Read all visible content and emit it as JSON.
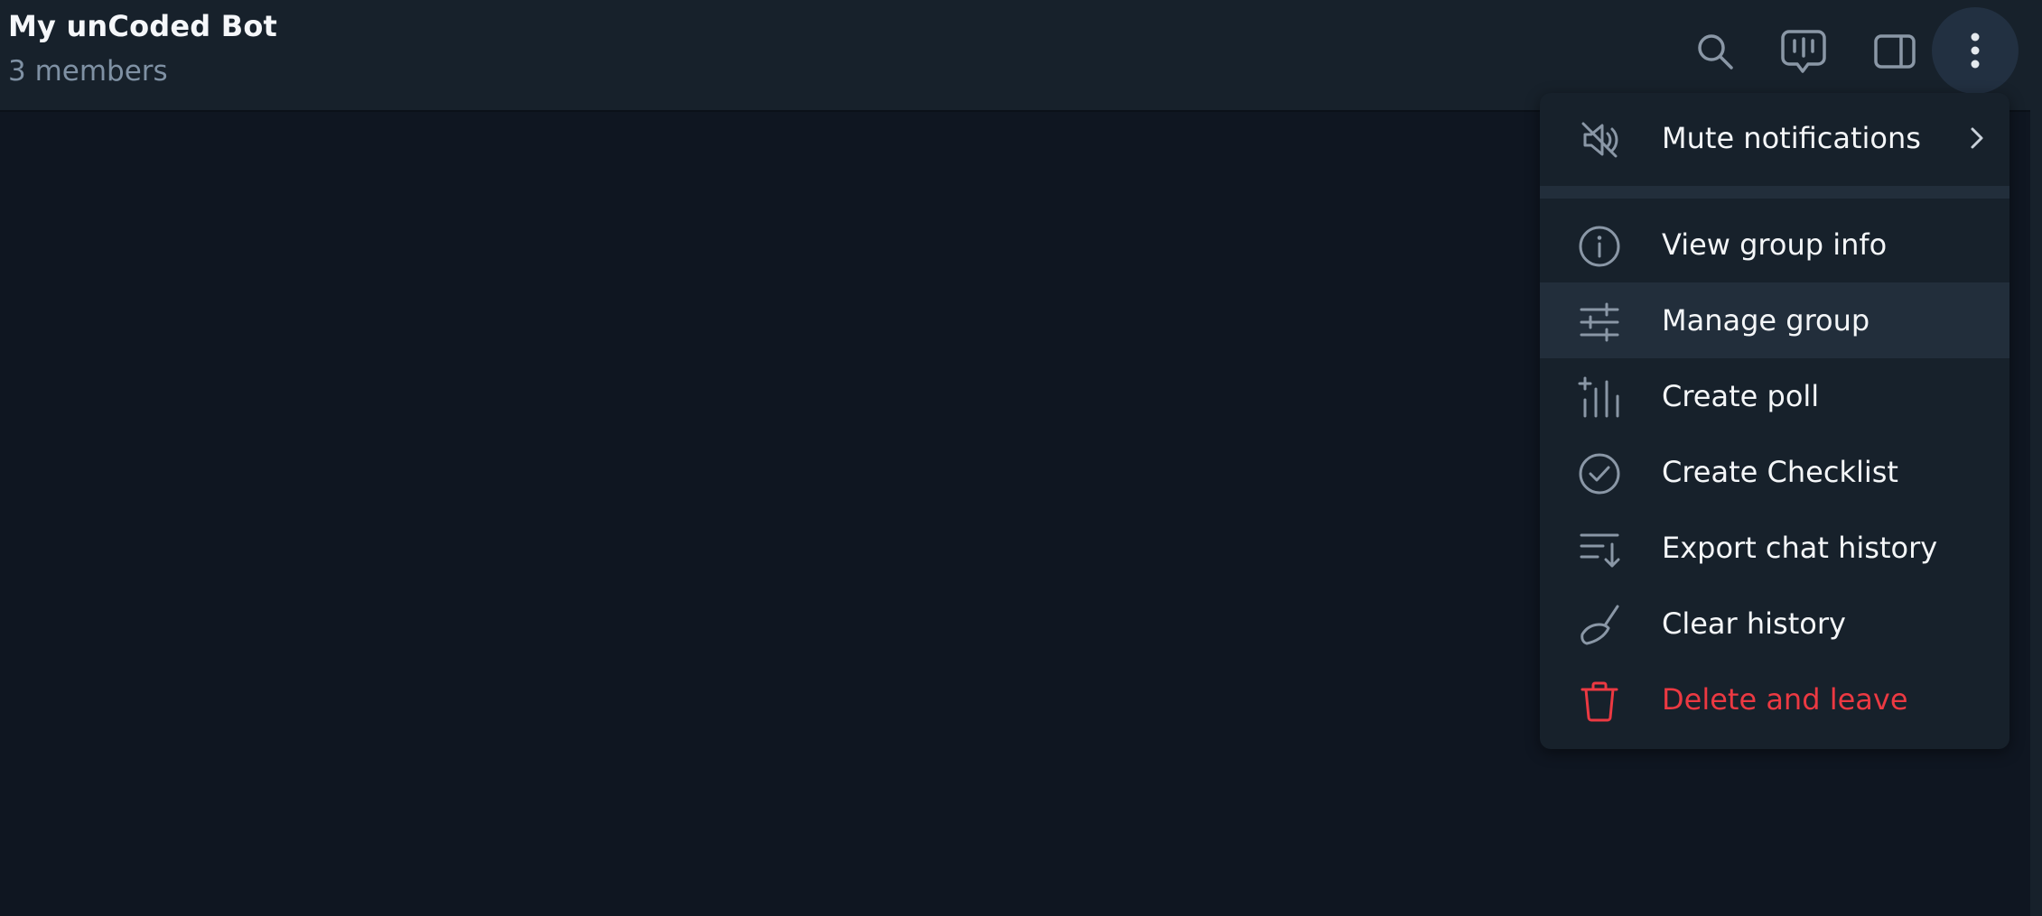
{
  "header": {
    "title": "My unCoded Bot",
    "subtitle": "3 members",
    "buttons": {
      "search": "search-icon",
      "video_chat": "video-chat-icon",
      "sidebar": "sidebar-toggle-icon",
      "more": "more-vertical-icon"
    }
  },
  "menu": {
    "items": [
      {
        "label": "Mute notifications",
        "icon": "muted-bell-icon",
        "has_submenu": true
      },
      {
        "label": "View group info",
        "icon": "info-icon"
      },
      {
        "label": "Manage group",
        "icon": "sliders-icon",
        "highlighted": true
      },
      {
        "label": "Create poll",
        "icon": "poll-icon"
      },
      {
        "label": "Create Checklist",
        "icon": "checklist-icon"
      },
      {
        "label": "Export chat history",
        "icon": "export-icon"
      },
      {
        "label": "Clear history",
        "icon": "broom-icon"
      },
      {
        "label": "Delete and leave",
        "icon": "trash-icon",
        "danger": true
      }
    ]
  },
  "colors": {
    "background": "#0f1621",
    "header": "#17212b",
    "menu": "#17212b",
    "highlight": "#222e3b",
    "text": "#f4f6f8",
    "muted_text": "#7f91a4",
    "icon": "#8a97a6",
    "danger": "#ec3942"
  }
}
